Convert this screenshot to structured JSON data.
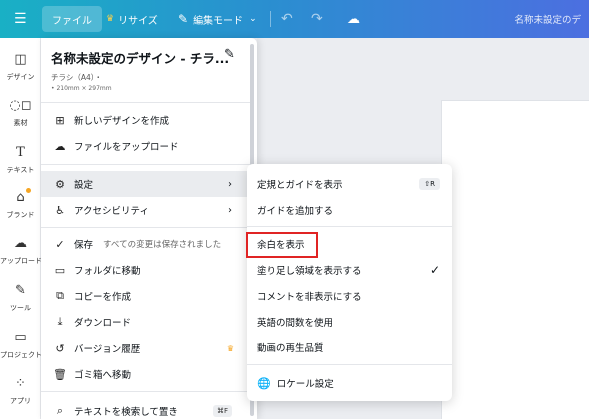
{
  "topbar": {
    "menu_icon": "hamburger-icon",
    "file": "ファイル",
    "resize": "リサイズ",
    "edit_mode": "編集モード",
    "doc_title": "名称未設定のデ"
  },
  "sidebar": {
    "items": [
      {
        "label": "デザイン",
        "icon": "layout-icon"
      },
      {
        "label": "素材",
        "icon": "shapes-icon"
      },
      {
        "label": "テキスト",
        "icon": "text-icon"
      },
      {
        "label": "ブランド",
        "icon": "brand-icon"
      },
      {
        "label": "アップロード",
        "icon": "upload-icon"
      },
      {
        "label": "ツール",
        "icon": "pen-tool-icon"
      },
      {
        "label": "プロジェクト",
        "icon": "folder-icon"
      },
      {
        "label": "アプリ",
        "icon": "apps-icon"
      }
    ]
  },
  "file_menu": {
    "title": "名称未設定のデザイン - チラ...",
    "subtitle": "チラシ（A4）・",
    "size": "• 210mm × 297mm",
    "items": [
      {
        "label": "新しいデザインを作成",
        "icon": "new-design-icon"
      },
      {
        "label": "ファイルをアップロード",
        "icon": "cloud-upload-icon"
      },
      {
        "label": "設定",
        "icon": "gear-icon"
      },
      {
        "label": "アクセシビリティ",
        "icon": "accessibility-icon"
      },
      {
        "label": "保存",
        "icon": "save-icon",
        "note": "すべての変更は保存されました"
      },
      {
        "label": "フォルダに移動",
        "icon": "folder-icon"
      },
      {
        "label": "コピーを作成",
        "icon": "copy-icon"
      },
      {
        "label": "ダウンロード",
        "icon": "download-icon"
      },
      {
        "label": "バージョン履歴",
        "icon": "history-icon"
      },
      {
        "label": "ゴミ箱へ移動",
        "icon": "trash-icon"
      },
      {
        "label": "テキストを検索して置き",
        "icon": "search-icon",
        "shortcut": "⌘F"
      }
    ]
  },
  "settings_submenu": {
    "items": [
      {
        "label": "定規とガイドを表示",
        "shortcut": "⇧R"
      },
      {
        "label": "ガイドを追加する"
      },
      {
        "label": "余白を表示"
      },
      {
        "label": "塗り足し領域を表示する",
        "checked": true
      },
      {
        "label": "コメントを非表示にする"
      },
      {
        "label": "英語の間数を使用"
      },
      {
        "label": "動画の再生品質"
      },
      {
        "label": "ロケール設定",
        "icon": "globe-icon"
      }
    ]
  },
  "colors": {
    "accent": "#2a8fd0",
    "highlight_border": "#e02424",
    "crown": "#f6a623"
  }
}
